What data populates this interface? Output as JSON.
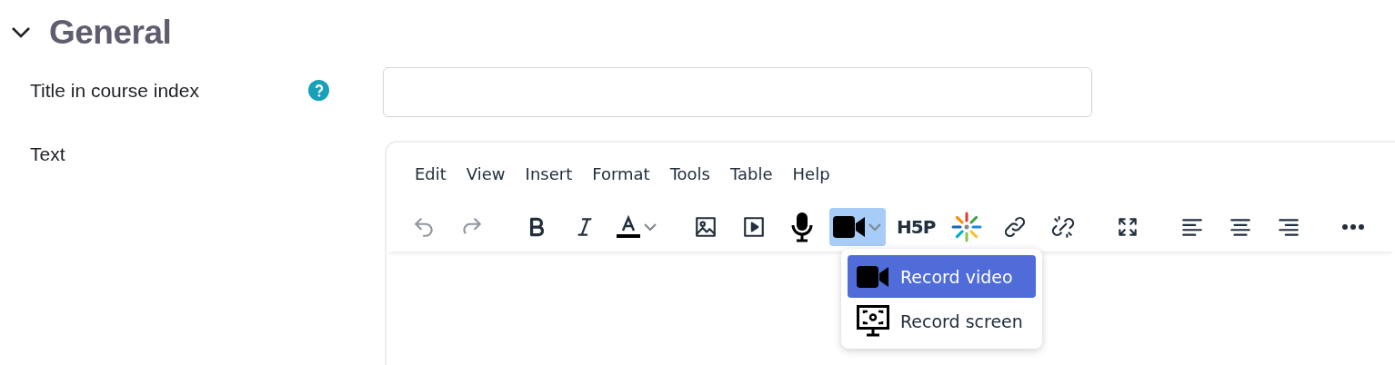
{
  "section": {
    "title": "General",
    "expanded": true
  },
  "fields": [
    {
      "label": "Title in course index",
      "help": true,
      "kind": "input"
    },
    {
      "label": "Text",
      "help": false,
      "kind": "editor"
    }
  ],
  "editor": {
    "menu": [
      "Edit",
      "View",
      "Insert",
      "Format",
      "Tools",
      "Table",
      "Help"
    ],
    "toolbar": [
      [
        {
          "kind": "undo",
          "disabled": true,
          "pressed": false
        },
        {
          "kind": "redo",
          "disabled": true,
          "pressed": false
        }
      ],
      [
        {
          "kind": "bold",
          "disabled": false,
          "pressed": false
        },
        {
          "kind": "italic",
          "disabled": false,
          "pressed": false
        },
        {
          "kind": "text-color",
          "disabled": false,
          "pressed": false
        }
      ],
      [
        {
          "kind": "image",
          "disabled": false,
          "pressed": false
        },
        {
          "kind": "media",
          "disabled": false,
          "pressed": false
        },
        {
          "kind": "microphone",
          "disabled": false,
          "pressed": false
        },
        {
          "kind": "video",
          "disabled": false,
          "pressed": true
        },
        {
          "kind": "logo",
          "text": "H5P",
          "disabled": false,
          "pressed": false
        },
        {
          "kind": "sparkle",
          "disabled": false,
          "pressed": false
        },
        {
          "kind": "link",
          "disabled": false,
          "pressed": false
        },
        {
          "kind": "unlink",
          "disabled": false,
          "pressed": false
        }
      ],
      [
        {
          "kind": "fullscreen",
          "disabled": false,
          "pressed": false
        }
      ],
      [
        {
          "kind": "align-left",
          "disabled": false,
          "pressed": false
        },
        {
          "kind": "align-center",
          "disabled": false,
          "pressed": false
        },
        {
          "kind": "align-right",
          "disabled": false,
          "pressed": false
        }
      ],
      [
        {
          "kind": "more",
          "disabled": false,
          "pressed": false
        }
      ]
    ],
    "dropdown": [
      {
        "label": "Record video",
        "kind": "video",
        "selected": true
      },
      {
        "label": "Record screen",
        "kind": "screen",
        "selected": false
      }
    ]
  }
}
